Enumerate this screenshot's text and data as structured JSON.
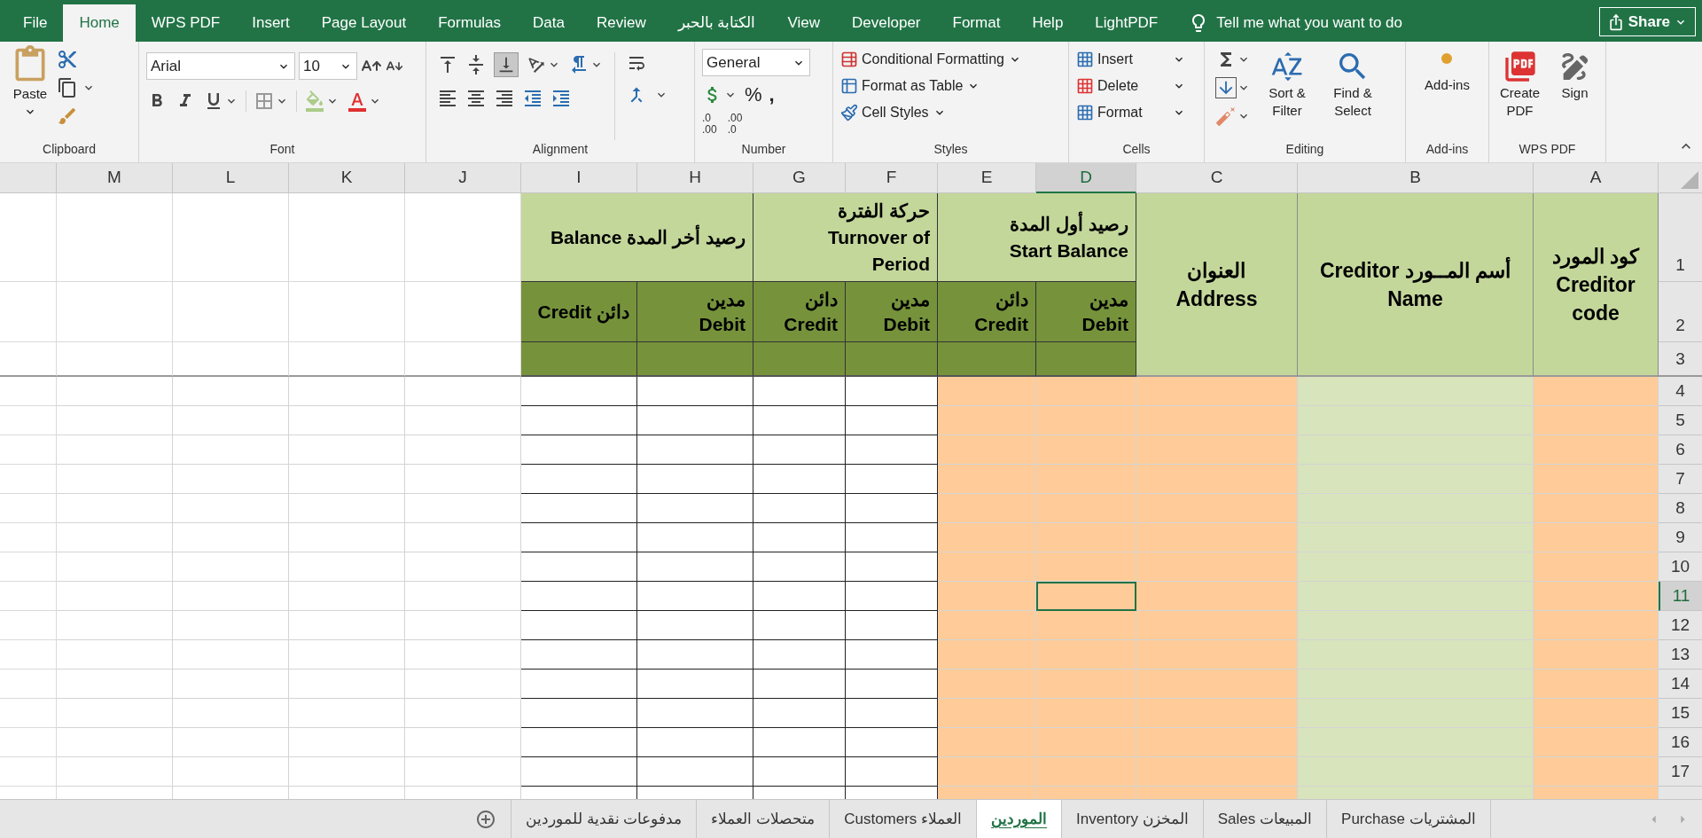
{
  "menu_tabs": [
    {
      "label": "File",
      "selected": false
    },
    {
      "label": "Home",
      "selected": true
    },
    {
      "label": "WPS PDF",
      "selected": false
    },
    {
      "label": "Insert",
      "selected": false
    },
    {
      "label": "Page Layout",
      "selected": false
    },
    {
      "label": "Formulas",
      "selected": false
    },
    {
      "label": "Data",
      "selected": false
    },
    {
      "label": "Review",
      "selected": false
    },
    {
      "label": "الكتابة بالحبر",
      "selected": false
    },
    {
      "label": "View",
      "selected": false
    },
    {
      "label": "Developer",
      "selected": false
    },
    {
      "label": "Format",
      "selected": false
    },
    {
      "label": "Help",
      "selected": false
    },
    {
      "label": "LightPDF",
      "selected": false
    }
  ],
  "tell_me": {
    "placeholder": "Tell me what you want to do"
  },
  "share_button": "Share",
  "ribbon": {
    "clipboard": {
      "label": "Clipboard",
      "paste": "Paste"
    },
    "font": {
      "label": "Font",
      "font_name": "Arial",
      "font_size": "10"
    },
    "alignment": {
      "label": "Alignment"
    },
    "number": {
      "label": "Number",
      "format": "General",
      "percent": "%",
      "comma": ",",
      "decimals": [
        {
          "top": ".0",
          "bottom": ".00"
        },
        {
          "top": ".00",
          "bottom": ".0"
        }
      ]
    },
    "styles": {
      "label": "Styles",
      "items": [
        "Conditional Formatting",
        "Format as Table",
        "Cell Styles"
      ]
    },
    "cells": {
      "label": "Cells",
      "items": [
        "Insert",
        "Delete",
        "Format"
      ]
    },
    "editing": {
      "label": "Editing",
      "items": [
        "Sort & Filter",
        "Find & Select"
      ]
    },
    "add_ins": {
      "label": "Add-ins",
      "button": "Add-ins"
    },
    "wps_pdf": {
      "label": "WPS PDF",
      "items": [
        "Create PDF",
        "Sign"
      ]
    }
  },
  "columns": [
    {
      "letter": "M",
      "selected": false,
      "color": "#ffffff",
      "border": false
    },
    {
      "letter": "L",
      "selected": false,
      "color": "#ffffff",
      "border": false
    },
    {
      "letter": "K",
      "selected": false,
      "color": "#ffffff",
      "border": false
    },
    {
      "letter": "J",
      "selected": false,
      "color": "#ffffff",
      "border": false
    },
    {
      "letter": "I",
      "selected": false,
      "color": "#ffffff",
      "border": true
    },
    {
      "letter": "H",
      "selected": false,
      "color": "#ffffff",
      "border": true
    },
    {
      "letter": "G",
      "selected": false,
      "color": "#ffffff",
      "border": true
    },
    {
      "letter": "F",
      "selected": false,
      "color": "#ffffff",
      "border": true
    },
    {
      "letter": "E",
      "selected": false,
      "color": "#ffcc99",
      "border": false
    },
    {
      "letter": "D",
      "selected": true,
      "color": "#ffcc99",
      "border": false
    },
    {
      "letter": "C",
      "selected": false,
      "color": "#ffcc99",
      "border": false
    },
    {
      "letter": "B",
      "selected": false,
      "color": "#d8e4bc",
      "border": false
    },
    {
      "letter": "A",
      "selected": false,
      "color": "#ffcc99",
      "border": false
    }
  ],
  "header_columns": [
    {
      "kind": "group",
      "lines": [
        "رصيد أخر المدة Balance"
      ],
      "sub": [
        {
          "lines": [
            "دائن Credit"
          ]
        },
        {
          "lines": [
            "مدين",
            "Debit"
          ]
        }
      ]
    },
    {
      "kind": "group",
      "lines": [
        "حركة الفترة",
        "Turnover of",
        "Period"
      ],
      "sub": [
        {
          "lines": [
            "دائن",
            "Credit"
          ]
        },
        {
          "lines": [
            "مدين",
            "Debit"
          ]
        }
      ]
    },
    {
      "kind": "group",
      "lines": [
        "رصيد أول المدة",
        "Start Balance"
      ],
      "sub": [
        {
          "lines": [
            "دائن",
            "Credit"
          ]
        },
        {
          "lines": [
            "مدين",
            "Debit"
          ]
        }
      ]
    },
    {
      "kind": "single",
      "lines": [
        "العنوان",
        "Address"
      ]
    },
    {
      "kind": "single",
      "lines": [
        "أسم المــورد Creditor",
        "Name"
      ]
    },
    {
      "kind": "single",
      "lines": [
        "كود المورد",
        "Creditor",
        "code"
      ]
    }
  ],
  "header_rows": [
    {
      "number": "1",
      "selected": false
    },
    {
      "number": "2",
      "selected": false
    },
    {
      "number": "3",
      "selected": false
    }
  ],
  "rows": [
    {
      "number": "4",
      "selected": false
    },
    {
      "number": "5",
      "selected": false
    },
    {
      "number": "6",
      "selected": false
    },
    {
      "number": "7",
      "selected": false
    },
    {
      "number": "8",
      "selected": false
    },
    {
      "number": "9",
      "selected": false
    },
    {
      "number": "10",
      "selected": false
    },
    {
      "number": "11",
      "selected": true
    },
    {
      "number": "12",
      "selected": false
    },
    {
      "number": "13",
      "selected": false
    },
    {
      "number": "14",
      "selected": false
    },
    {
      "number": "15",
      "selected": false
    },
    {
      "number": "16",
      "selected": false
    },
    {
      "number": "17",
      "selected": false
    }
  ],
  "sheet_tabs": [
    {
      "label": "المشتريات Purchase",
      "selected": false
    },
    {
      "label": "المبيعات Sales",
      "selected": false
    },
    {
      "label": "المخزن Inventory",
      "selected": false
    },
    {
      "label": "الموردين",
      "selected": true
    },
    {
      "label": "العملاء Customers",
      "selected": false
    },
    {
      "label": "متحصلات العملاء",
      "selected": false
    },
    {
      "label": "مدفوعات نقدية للموردين",
      "selected": false
    }
  ]
}
